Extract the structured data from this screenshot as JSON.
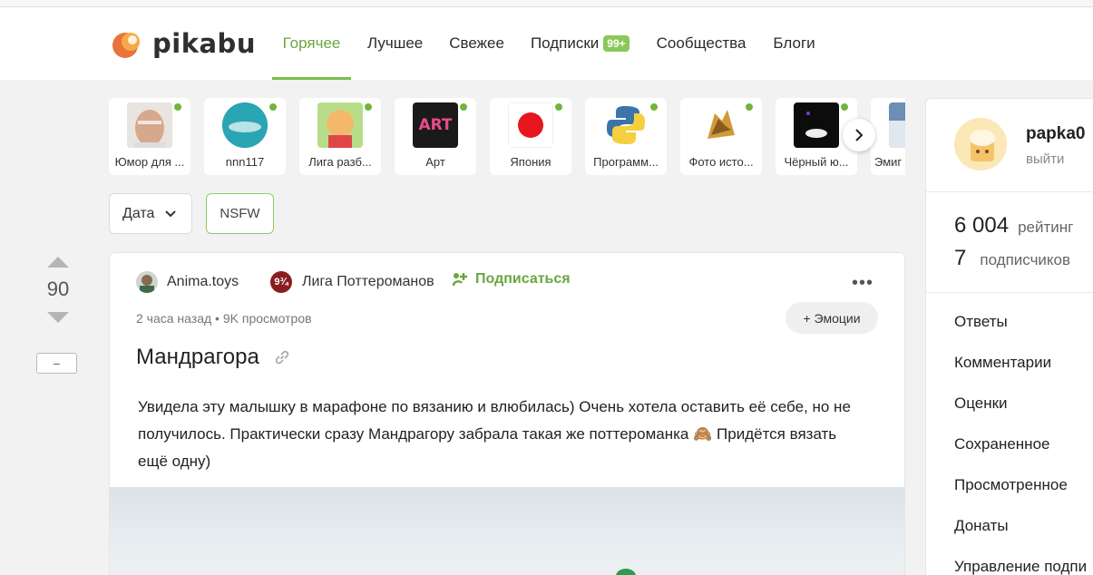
{
  "header": {
    "logo_text": "pikabu",
    "nav": [
      {
        "label": "Горячее",
        "active": true
      },
      {
        "label": "Лучшее"
      },
      {
        "label": "Свежее"
      },
      {
        "label": "Подписки",
        "badge": "99+"
      },
      {
        "label": "Сообщества"
      },
      {
        "label": "Блоги"
      }
    ]
  },
  "stories": [
    {
      "label": "Юмор для ..."
    },
    {
      "label": "nnn117"
    },
    {
      "label": "Лига разб..."
    },
    {
      "label": "Арт",
      "image_text": "ART"
    },
    {
      "label": "Япония"
    },
    {
      "label": "Программ..."
    },
    {
      "label": "Фото исто..."
    },
    {
      "label": "Чёрный ю..."
    },
    {
      "label": "Эмиг"
    }
  ],
  "filters": {
    "date_label": "Дата",
    "nsfw_label": "NSFW"
  },
  "vote": {
    "count": "90",
    "minus_label": "−"
  },
  "post": {
    "author": "Anima.toys",
    "community": "Лига Поттероманов",
    "community_avatar_text": "9¾",
    "subscribe_label": "Подписаться",
    "more_label": "•••",
    "meta": "2 часа назад • 9K просмотров",
    "emotions_label": "+ Эмоции",
    "title": "Мандрагора",
    "body_line1": "Увидела эту малышку в марафоне по вязанию и влюбилась) Очень хотела оставить её себе, но не",
    "body_line2_a": "получилось. Практически сразу Мандрагору забрала такая же поттероманка",
    "body_emoji": "🙈",
    "body_line2_b": "Придётся вязать",
    "body_line3": "ещё одну)"
  },
  "sidebar": {
    "username": "papka0",
    "logout": "выйти",
    "rating_value": "6 004",
    "rating_label": "рейтинг",
    "subscribers_value": "7",
    "subscribers_label": "подписчиков",
    "menu": [
      "Ответы",
      "Комментарии",
      "Оценки",
      "Сохраненное",
      "Просмотренное",
      "Донаты",
      "Управление подпи"
    ]
  },
  "colors": {
    "accent": "#79bd49",
    "accent_text": "#6ba53e",
    "badge": "#8ac858",
    "online_dot": "#71b43e"
  }
}
